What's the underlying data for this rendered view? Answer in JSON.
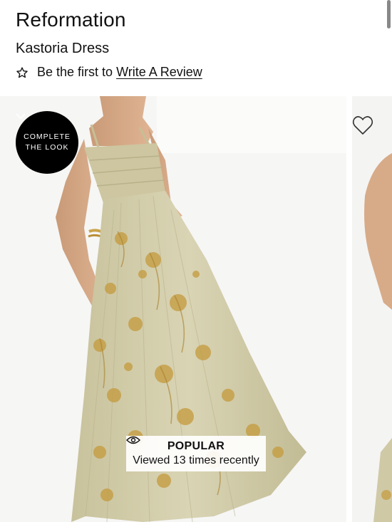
{
  "brand": "Reformation",
  "product": {
    "name": "Kastoria Dress"
  },
  "review": {
    "prompt": "Be the first to",
    "link_label": "Write A Review",
    "star_icon": "star-outline-icon"
  },
  "gallery": {
    "complete_look": {
      "line1": "COMPLETE",
      "line2": "THE LOOK",
      "icon": "chevron-down-icon"
    },
    "favorite_icon": "heart-outline-icon",
    "badge": {
      "icon": "eye-icon",
      "title": "POPULAR",
      "subtitle": "Viewed 13 times recently"
    }
  },
  "colors": {
    "text": "#111111",
    "badge_bg": "#ffffff",
    "circle_bg": "#000000",
    "dress": "#cfc9a6",
    "print": "#c49a3c"
  }
}
